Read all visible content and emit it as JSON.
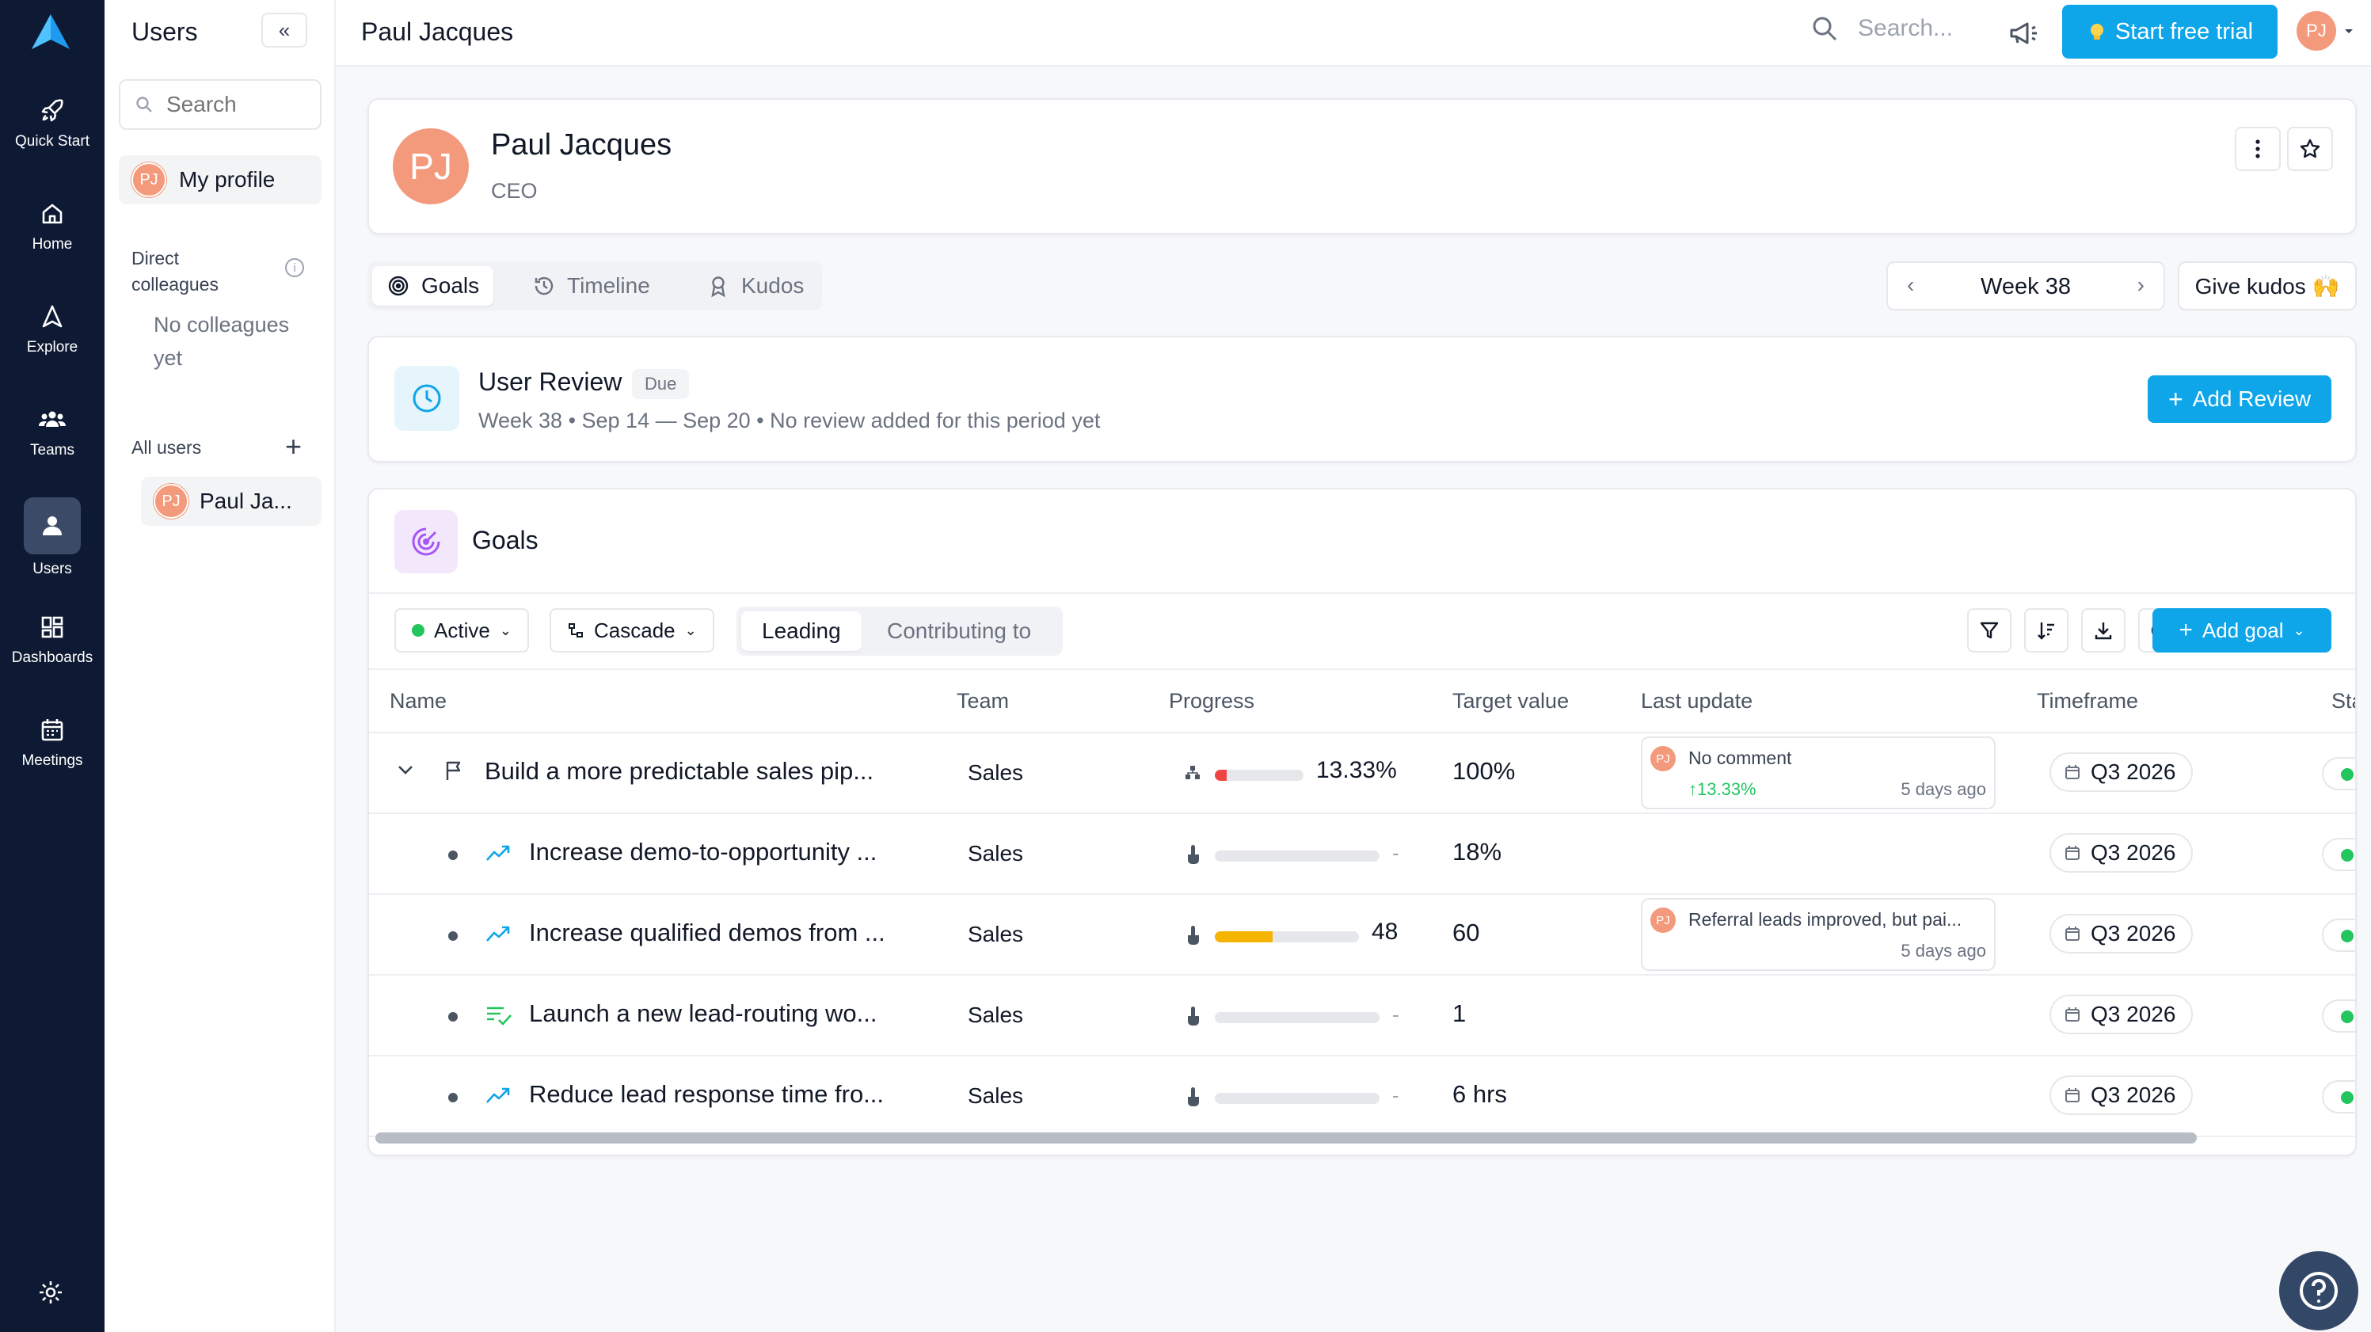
{
  "rail": {
    "items": [
      {
        "label": "Quick Start"
      },
      {
        "label": "Home"
      },
      {
        "label": "Explore"
      },
      {
        "label": "Teams"
      },
      {
        "label": "Users"
      },
      {
        "label": "Dashboards"
      },
      {
        "label": "Meetings"
      }
    ]
  },
  "sidebar": {
    "title": "Users",
    "collapse_label": "«",
    "search_placeholder": "Search",
    "my_profile_label": "My profile",
    "direct_colleagues_label": "Direct colleagues",
    "info_glyph": "i",
    "no_colleagues_text": "No colleagues yet",
    "all_users_label": "All users",
    "add_glyph": "+",
    "users": [
      {
        "initials": "PJ",
        "name": "Paul Ja..."
      }
    ]
  },
  "topbar": {
    "page_title": "Paul Jacques",
    "search_placeholder": "Search...",
    "trial_button": "Start free trial",
    "avatar_initials": "PJ"
  },
  "profile": {
    "initials": "PJ",
    "name": "Paul Jacques",
    "role": "CEO"
  },
  "tabs": [
    {
      "label": "Goals",
      "active": true
    },
    {
      "label": "Timeline",
      "active": false
    },
    {
      "label": "Kudos",
      "active": false
    }
  ],
  "week_nav": {
    "label": "Week 38"
  },
  "kudos_button": "Give kudos 🙌",
  "review": {
    "title": "User Review",
    "badge": "Due",
    "subtitle": "Week 38 • Sep 14 — Sep 20 • No review added for this period yet",
    "add_button": "Add Review"
  },
  "goals": {
    "title": "Goals",
    "filters": {
      "status": "Active",
      "cascade": "Cascade",
      "segments": [
        "Leading",
        "Contributing to"
      ]
    },
    "add_goal_button": "Add goal",
    "columns": [
      "Name",
      "Team",
      "Progress",
      "Target value",
      "Last update",
      "Timeframe",
      "Sta"
    ],
    "rows": [
      {
        "name": "Build a more predictable sales pip...",
        "team": "Sales",
        "progress": 13.33,
        "progress_label": "13.33%",
        "target": "100%",
        "update_comment": "No comment",
        "update_change": "↑13.33%",
        "update_ago": "5 days ago",
        "timeframe": "Q3 2026"
      },
      {
        "name": "Increase demo-to-opportunity ...",
        "team": "Sales",
        "progress": 0,
        "progress_label": "-",
        "target": "18%",
        "timeframe": "Q3 2026"
      },
      {
        "name": "Increase qualified demos from ...",
        "team": "Sales",
        "progress": 40,
        "progress_label": "48",
        "target": "60",
        "update_comment": "Referral leads improved, but pai...",
        "update_ago": "5 days ago",
        "timeframe": "Q3 2026"
      },
      {
        "name": "Launch a new lead-routing wo...",
        "team": "Sales",
        "progress": 0,
        "progress_label": "-",
        "target": "1",
        "timeframe": "Q3 2026"
      },
      {
        "name": "Reduce lead response time fro...",
        "team": "Sales",
        "progress": 0,
        "progress_label": "-",
        "target": "6 hrs",
        "timeframe": "Q3 2026"
      }
    ]
  },
  "colors": {
    "accent": "#0ea5e9",
    "rail_bg": "#0e1a33",
    "avatar": "#f39a7c",
    "progress_red": "#ef4444",
    "progress_amber": "#f5b400",
    "success": "#22c55e"
  }
}
